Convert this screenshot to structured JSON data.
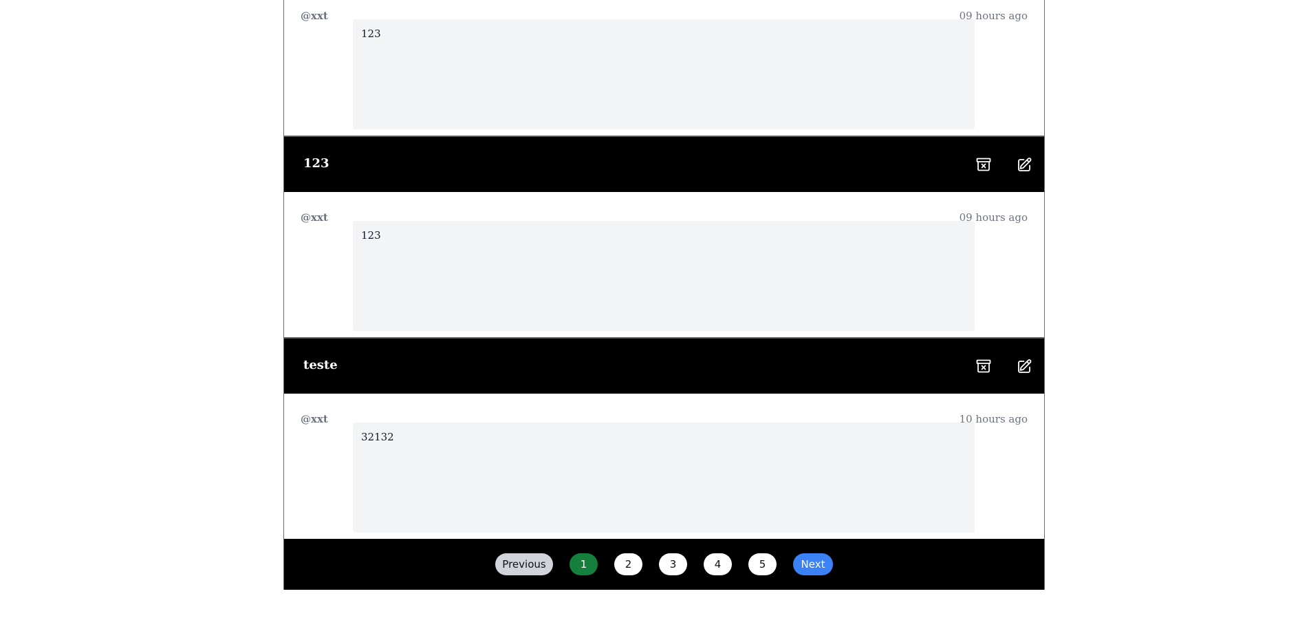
{
  "posts": [
    {
      "title": "",
      "author": "@xxt",
      "time": "09 hours ago",
      "content": "123"
    },
    {
      "title": "123",
      "author": "@xxt",
      "time": "09 hours ago",
      "content": "123"
    },
    {
      "title": "teste",
      "author": "@xxt",
      "time": "10 hours ago",
      "content": "32132"
    }
  ],
  "pagination": {
    "previous_label": "Previous",
    "next_label": "Next",
    "pages": [
      "1",
      "2",
      "3",
      "4",
      "5"
    ],
    "current_page": "1"
  },
  "icons": {
    "archive": "archive-box-x-icon",
    "edit": "pencil-square-icon"
  },
  "colors": {
    "header_bg": "#000000",
    "content_bg": "#f3f4f6",
    "active_page": "#15803d",
    "next_button": "#3b82f6",
    "previous_button": "#d1d5db",
    "meta_text": "#6b7280"
  }
}
